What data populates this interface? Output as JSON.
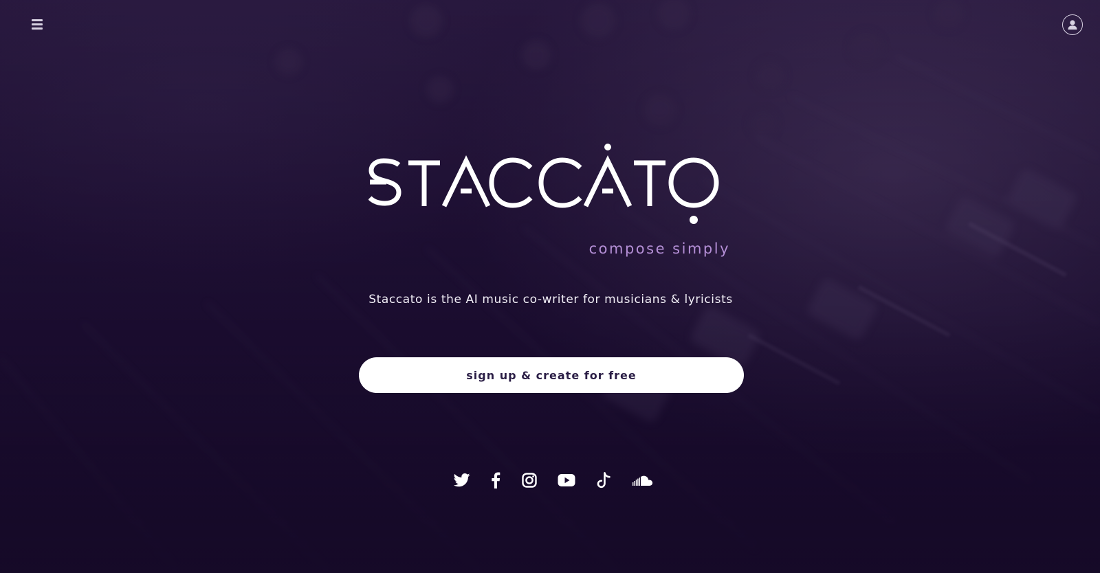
{
  "header": {
    "menu_icon": "hamburger-menu-icon",
    "account_icon": "user-account-icon"
  },
  "hero": {
    "logo_text": "STACCATO",
    "tagline": "compose simply",
    "subtitle": "Staccato is the AI music co-writer for musicians & lyricists",
    "cta_label": "sign up & create for free"
  },
  "social": [
    {
      "icon": "twitter-icon"
    },
    {
      "icon": "facebook-icon"
    },
    {
      "icon": "instagram-icon"
    },
    {
      "icon": "youtube-icon"
    },
    {
      "icon": "tiktok-icon"
    },
    {
      "icon": "soundcloud-icon"
    }
  ],
  "colors": {
    "background": "#1d0f32",
    "accent": "#b48fd6",
    "button_bg": "#ffffff",
    "button_text": "#2a1d45",
    "foreground": "#ffffff"
  }
}
